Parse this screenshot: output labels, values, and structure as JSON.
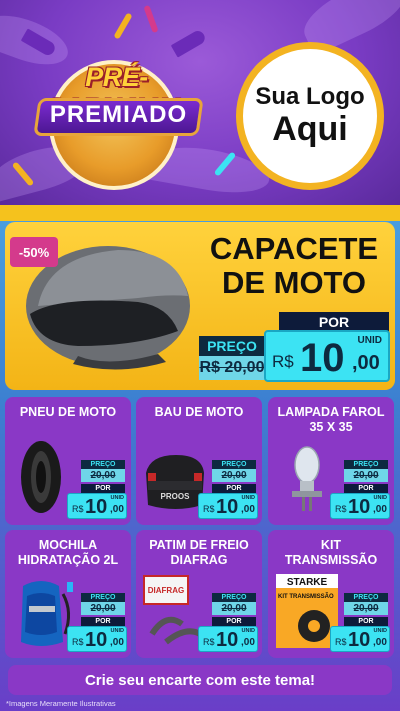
{
  "header": {
    "logo_line1": "PRÉ-CARNAVAL",
    "logo_line2": "PREMIADO",
    "brand_line1": "Sua Logo",
    "brand_line2": "Aqui"
  },
  "hero": {
    "discount": "-50%",
    "title_line1": "CAPACETE",
    "title_line2": "DE MOTO",
    "preco_label": "PREÇO",
    "old_price": "R$ 20,00",
    "por_label": "POR",
    "unid_label": "UNID",
    "currency": "R$",
    "price_int": "10",
    "price_dec": ",00"
  },
  "cards": [
    {
      "title_l1": "PNEU DE MOTO",
      "title_l2": "",
      "preco": "PREÇO",
      "old": "20,00",
      "por": "POR",
      "unid": "UNID",
      "cur": "R$",
      "int": "10",
      "dec": ",00"
    },
    {
      "title_l1": "BAU DE MOTO",
      "title_l2": "",
      "preco": "PREÇO",
      "old": "20,00",
      "por": "POR",
      "unid": "UNID",
      "cur": "R$",
      "int": "10",
      "dec": ",00"
    },
    {
      "title_l1": "LAMPADA FAROL",
      "title_l2": "35 X 35",
      "preco": "PREÇO",
      "old": "20,00",
      "por": "POR",
      "unid": "UNID",
      "cur": "R$",
      "int": "10",
      "dec": ",00"
    },
    {
      "title_l1": "MOCHILA",
      "title_l2": "HIDRATAÇÃO 2L",
      "preco": "PREÇO",
      "old": "20,00",
      "por": "POR",
      "unid": "UNID",
      "cur": "R$",
      "int": "10",
      "dec": ",00"
    },
    {
      "title_l1": "PATIM DE FREIO",
      "title_l2": "DIAFRAG",
      "preco": "PREÇO",
      "old": "20,00",
      "por": "POR",
      "unid": "UNID",
      "cur": "R$",
      "int": "10",
      "dec": ",00"
    },
    {
      "title_l1": "KIT",
      "title_l2": "TRANSMISSÃO",
      "preco": "PREÇO",
      "old": "20,00",
      "por": "POR",
      "unid": "UNID",
      "cur": "R$",
      "int": "10",
      "dec": ",00"
    }
  ],
  "product_labels": {
    "box_brand": "PROOS",
    "brake_brand": "DIAFRAG",
    "kit_brand": "STARKE",
    "kit_label": "KIT TRANSMISSÃO"
  },
  "cta_text": "Crie seu encarte com este tema!",
  "footnote": "*Imagens Meramente Ilustrativas",
  "colors": {
    "purple": "#8a38c6",
    "yellow": "#f5c21d",
    "cyan": "#3ce3f3",
    "navy": "#0d1b3a",
    "pink": "#d43a8c"
  }
}
